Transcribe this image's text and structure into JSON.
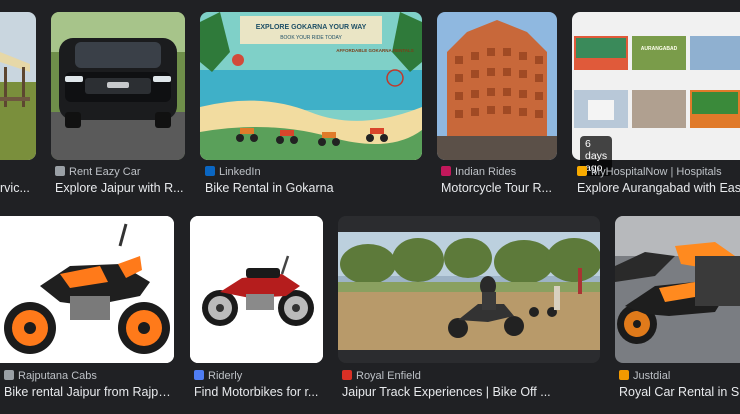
{
  "results_row1": [
    {
      "source": "",
      "title": "rvic..."
    },
    {
      "source": "Rent Eazy Car",
      "title": "Explore Jaipur with R..."
    },
    {
      "source": "LinkedIn",
      "title": "Bike Rental in Gokarna",
      "image_text": {
        "line1": "EXPLORE GOKARNA YOUR WAY",
        "line2": "BOOK YOUR RIDE TODAY",
        "line3": "AFFORDABLE GOKARNA RENTALS"
      }
    },
    {
      "source": "Indian Rides",
      "title": "Motorcycle Tour R..."
    },
    {
      "source": "MyHospitalNow | Hospitals",
      "title": "Explore Aurangabad with Ease",
      "badge": "6 days ago",
      "image_text": {
        "tile": "AURANGABAD"
      }
    }
  ],
  "results_row2": [
    {
      "source": "Rajputana Cabs",
      "title": "Bike rental Jaipur from Rajpu..."
    },
    {
      "source": "Riderly",
      "title": "Find Motorbikes for r..."
    },
    {
      "source": "Royal Enfield",
      "title": "Jaipur Track Experiences | Bike Off ..."
    },
    {
      "source": "Justdial",
      "title": "Royal Car Rental in Sita"
    }
  ],
  "colors": {
    "background": "#202124",
    "text_primary": "#e8eaed",
    "text_secondary": "#bdc1c6",
    "linkedin": "#0a66c2",
    "indian_rides": "#c2185b",
    "rent_eazy": "#9aa0a6",
    "royal_enfield": "#d93025",
    "justdial": "#f29900",
    "riderly": "#4f7df3",
    "myhospitalnow": "#f9ab00"
  },
  "icons": {
    "rent_eazy": "car-icon",
    "linkedin": "linkedin-icon",
    "indian_rides": "indian-rides-icon",
    "myhospitalnow": "hospital-icon",
    "rajputana": "rajputana-icon",
    "riderly": "riderly-icon",
    "royal_enfield": "royal-enfield-icon",
    "justdial": "justdial-icon"
  }
}
